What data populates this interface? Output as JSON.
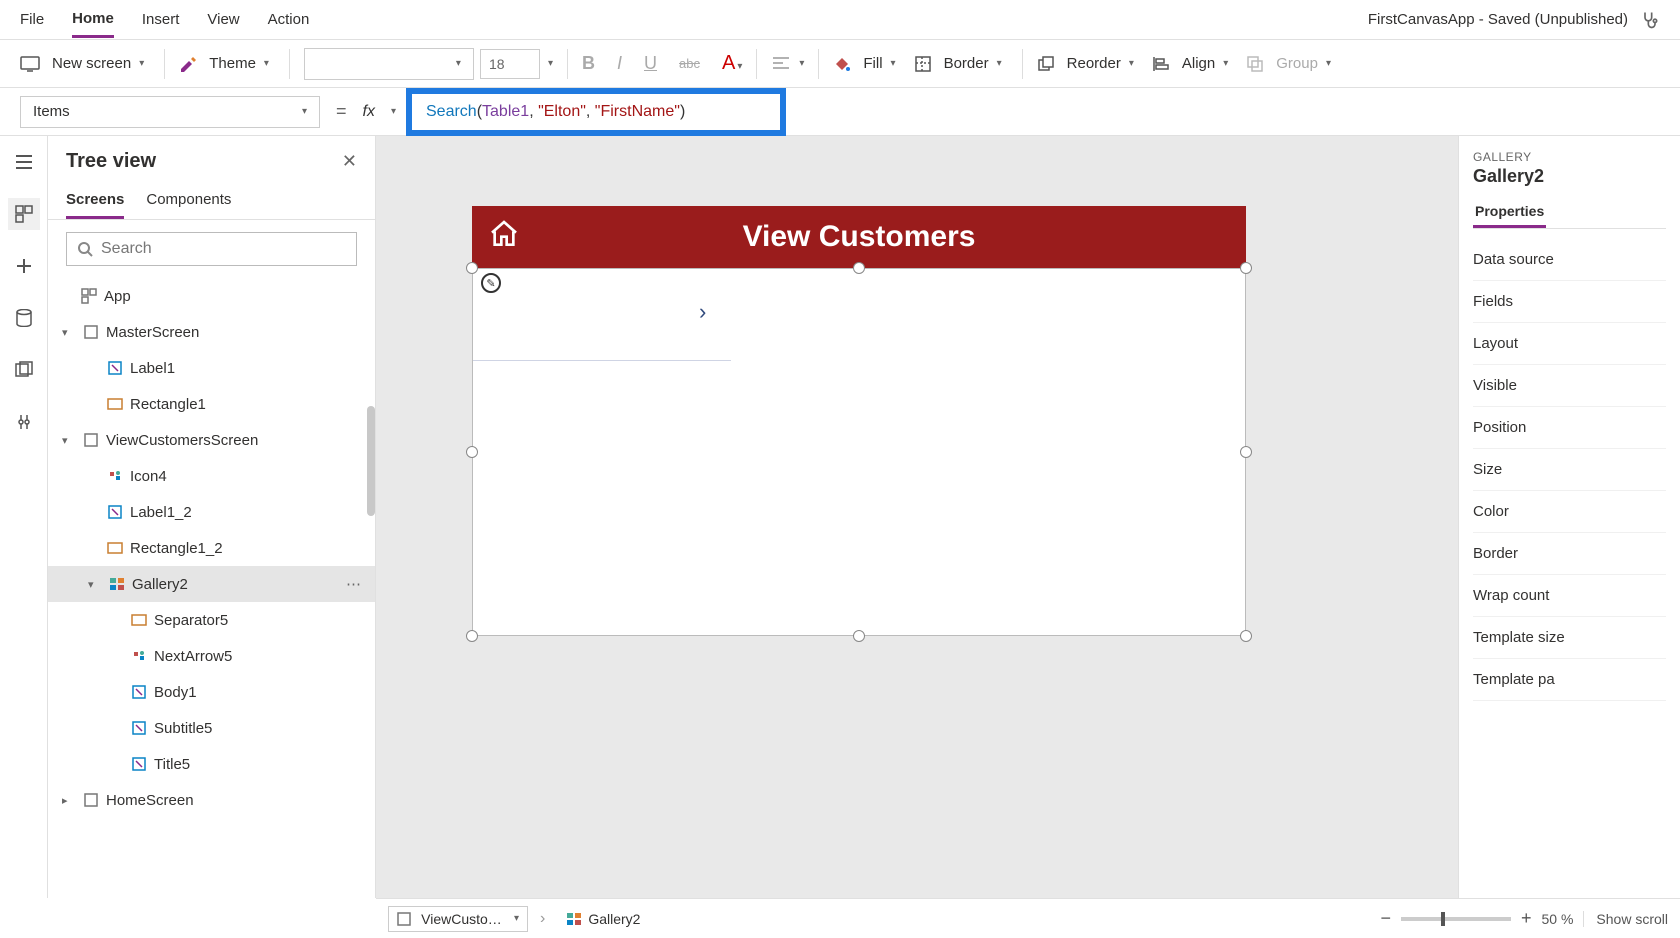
{
  "menu": {
    "file": "File",
    "home": "Home",
    "insert": "Insert",
    "view": "View",
    "action": "Action"
  },
  "doc_title": "FirstCanvasApp - Saved (Unpublished)",
  "ribbon": {
    "new_screen": "New screen",
    "theme": "Theme",
    "font_size": "18",
    "fill": "Fill",
    "border": "Border",
    "reorder": "Reorder",
    "align": "Align",
    "group": "Group"
  },
  "formula": {
    "property": "Items",
    "tokens": {
      "fn": "Search",
      "open": "(",
      "t": "Table1",
      "c1": ", ",
      "s1": "\"Elton\"",
      "c2": ", ",
      "s2": "\"FirstName\"",
      "close": ")"
    }
  },
  "tree": {
    "title": "Tree view",
    "tabs": {
      "screens": "Screens",
      "components": "Components"
    },
    "search_placeholder": "Search",
    "app": "App",
    "nodes": [
      {
        "name": "MasterScreen"
      },
      {
        "name": "Label1"
      },
      {
        "name": "Rectangle1"
      },
      {
        "name": "ViewCustomersScreen"
      },
      {
        "name": "Icon4"
      },
      {
        "name": "Label1_2"
      },
      {
        "name": "Rectangle1_2"
      },
      {
        "name": "Gallery2"
      },
      {
        "name": "Separator5"
      },
      {
        "name": "NextArrow5"
      },
      {
        "name": "Body1"
      },
      {
        "name": "Subtitle5"
      },
      {
        "name": "Title5"
      },
      {
        "name": "HomeScreen"
      }
    ]
  },
  "canvas": {
    "title": "View Customers"
  },
  "props": {
    "section": "GALLERY",
    "name": "Gallery2",
    "tab": "Properties",
    "rows": [
      "Data source",
      "Fields",
      "Layout",
      "Visible",
      "Position",
      "Size",
      "Color",
      "Border",
      "Wrap count",
      "Template size",
      "Template pa"
    ]
  },
  "status": {
    "crumb1": "ViewCusto…",
    "crumb2": "Gallery2",
    "zoom": "50 %",
    "scroll": "Show scroll"
  }
}
